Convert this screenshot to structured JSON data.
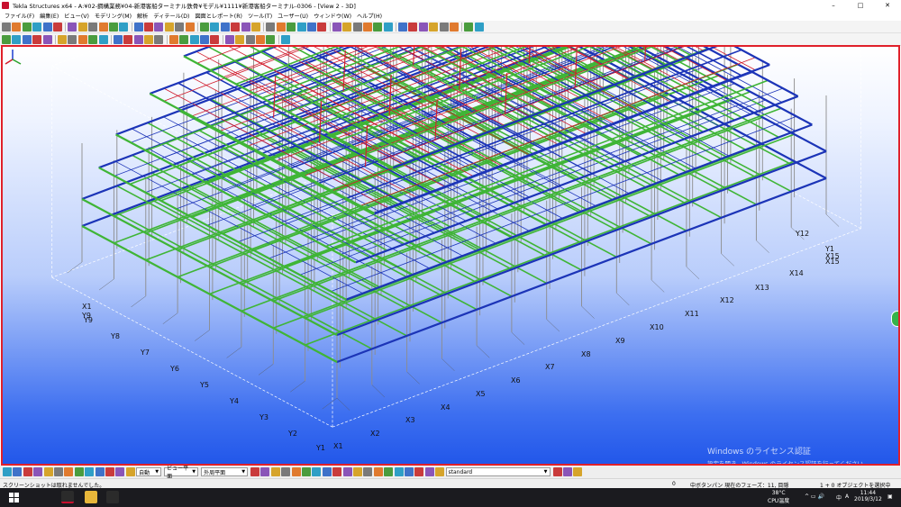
{
  "window": {
    "title": "Tekla Structures x64 - A:¥02-鋼構業務¥04-新港客船ターミナル鉄骨¥モデル¥1111¥新港客船ターミナル-0306 - [View 2 - 3D]",
    "controls": [
      "–",
      "□",
      "✕"
    ]
  },
  "menu": [
    "ファイル(F)",
    "編集(E)",
    "ビュー(V)",
    "モデリング(M)",
    "解析",
    "ディテール(D)",
    "図面とレポート(R)",
    "ツール(T)",
    "ユーザー(U)",
    "ウィンドウ(W)",
    "ヘルプ(H)"
  ],
  "grid_labels": {
    "x": [
      "X1",
      "X2",
      "X3",
      "X4",
      "X5",
      "X6",
      "X7",
      "X8",
      "X9",
      "X10",
      "X11",
      "X12",
      "X13",
      "X14",
      "X15"
    ],
    "y": [
      "Y1",
      "Y2",
      "Y3",
      "Y4",
      "Y5",
      "Y6",
      "Y7",
      "Y8",
      "Y9"
    ],
    "far_x1": "X1",
    "far_y9": "Y9",
    "far_y1": "Y1",
    "far_x15": "X15",
    "far_y12": "Y12"
  },
  "watermark": {
    "title": "Windows のライセンス認証",
    "subtitle": "設定を開き、Windows のライセンス認証を行ってください。"
  },
  "bottom_toolbar": {
    "select_auto": "自動",
    "select_view_plane": "ビュー平面",
    "select_outer_plane": "外周平面",
    "select_standard": "standard"
  },
  "status": {
    "left": "スクリーンショットは取れませんでした。",
    "count": "0",
    "middle": "中ボタンパン  現在のフェーズ：11, 目隠",
    "right": "1 + 0 オブジェクトを選択中"
  },
  "taskbar": {
    "temp": "38°C",
    "cpu": "CPU温度",
    "time": "11:44",
    "date": "2019/3/12",
    "ime_mode": "中",
    "ime_a": "A"
  },
  "colors": {
    "viewport_border": "#e0202a",
    "beam_green": "#3fb536",
    "beam_blue": "#1c34b8",
    "beam_red": "#d11b2b",
    "column_gray": "#8c8c8c"
  }
}
